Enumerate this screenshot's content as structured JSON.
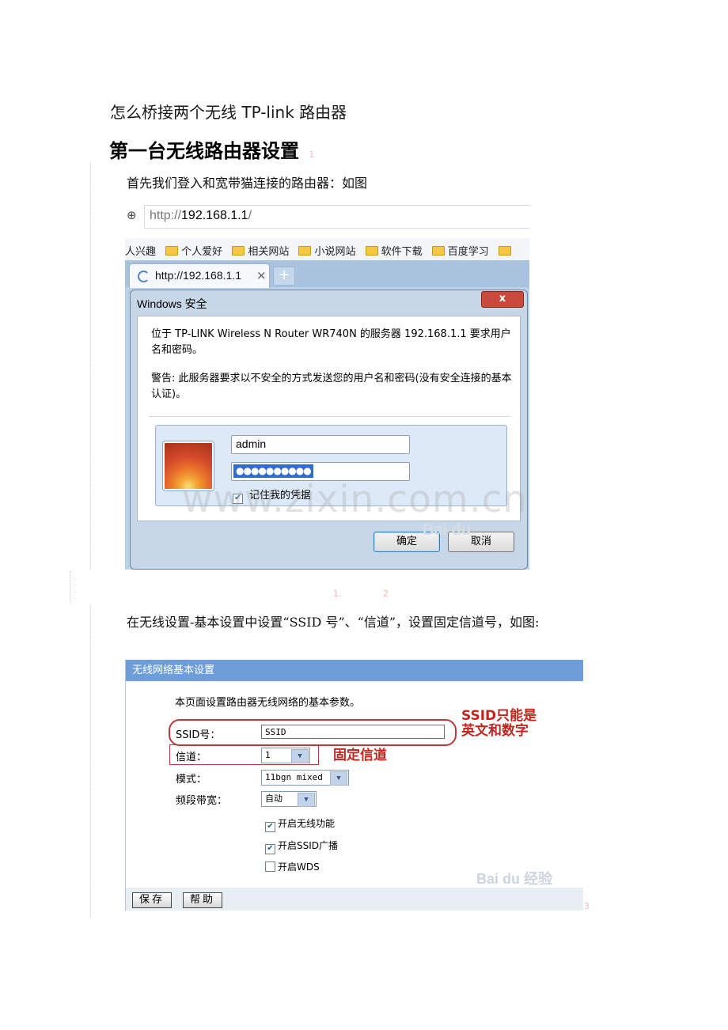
{
  "doc_title": "怎么桥接两个无线 TP-link 路由器",
  "section_heading": "第一台无线路由器设置",
  "heading_marker": "1",
  "intro_text": "首先我们登入和宽带猫连接的路由器：如图",
  "browser": {
    "url_prefix": "http://",
    "url_host": "192.168.1.1",
    "url_suffix": "/",
    "bookmarks": [
      "人兴趣",
      "个人爱好",
      "相关网站",
      "小说网站",
      "软件下载",
      "百度学习"
    ],
    "tab_title": "http://192.168.1.1",
    "tab_close": "×",
    "new_tab": "+"
  },
  "dialog": {
    "title": "Windows 安全",
    "close": "x",
    "message": "位于 TP-LINK Wireless N Router WR740N 的服务器 192.168.1.1 要求用户名和密码。",
    "warning": "警告: 此服务器要求以不安全的方式发送您的用户名和密码(没有安全连接的基本认证)。",
    "username": "admin",
    "password_mask": "●●●●●●●●●●",
    "remember_label": "记住我的凭据",
    "ok_label": "确定",
    "cancel_label": "取消"
  },
  "baidu_logo_1": "Bai du",
  "watermark": "www.zixin.com.cn",
  "page_marks": [
    "1.",
    "2"
  ],
  "step2_text": "在无线设置-基本设置中设置“SSID 号”、“信道”，设置固定信道号，如图:",
  "wireless": {
    "header": "无线网络基本设置",
    "description": "本页面设置路由器无线网络的基本参数。",
    "ssid_label": "SSID号：",
    "ssid_value": "SSID",
    "channel_label": "信道：",
    "channel_value": "1",
    "mode_label": "模式：",
    "mode_value": "11bgn mixed",
    "bandwidth_label": "频段带宽：",
    "bandwidth_value": "自动",
    "enable_wireless": "开启无线功能",
    "enable_ssid_broadcast": "开启SSID广播",
    "enable_wds": "开启WDS",
    "save_label": "保存",
    "help_label": "帮助",
    "note_ssid_line1": "SSID只能是",
    "note_ssid_line2": "英文和数字",
    "note_channel": "固定信道"
  },
  "baidu_logo_2": "Bai du 经验",
  "end_marker": "3"
}
